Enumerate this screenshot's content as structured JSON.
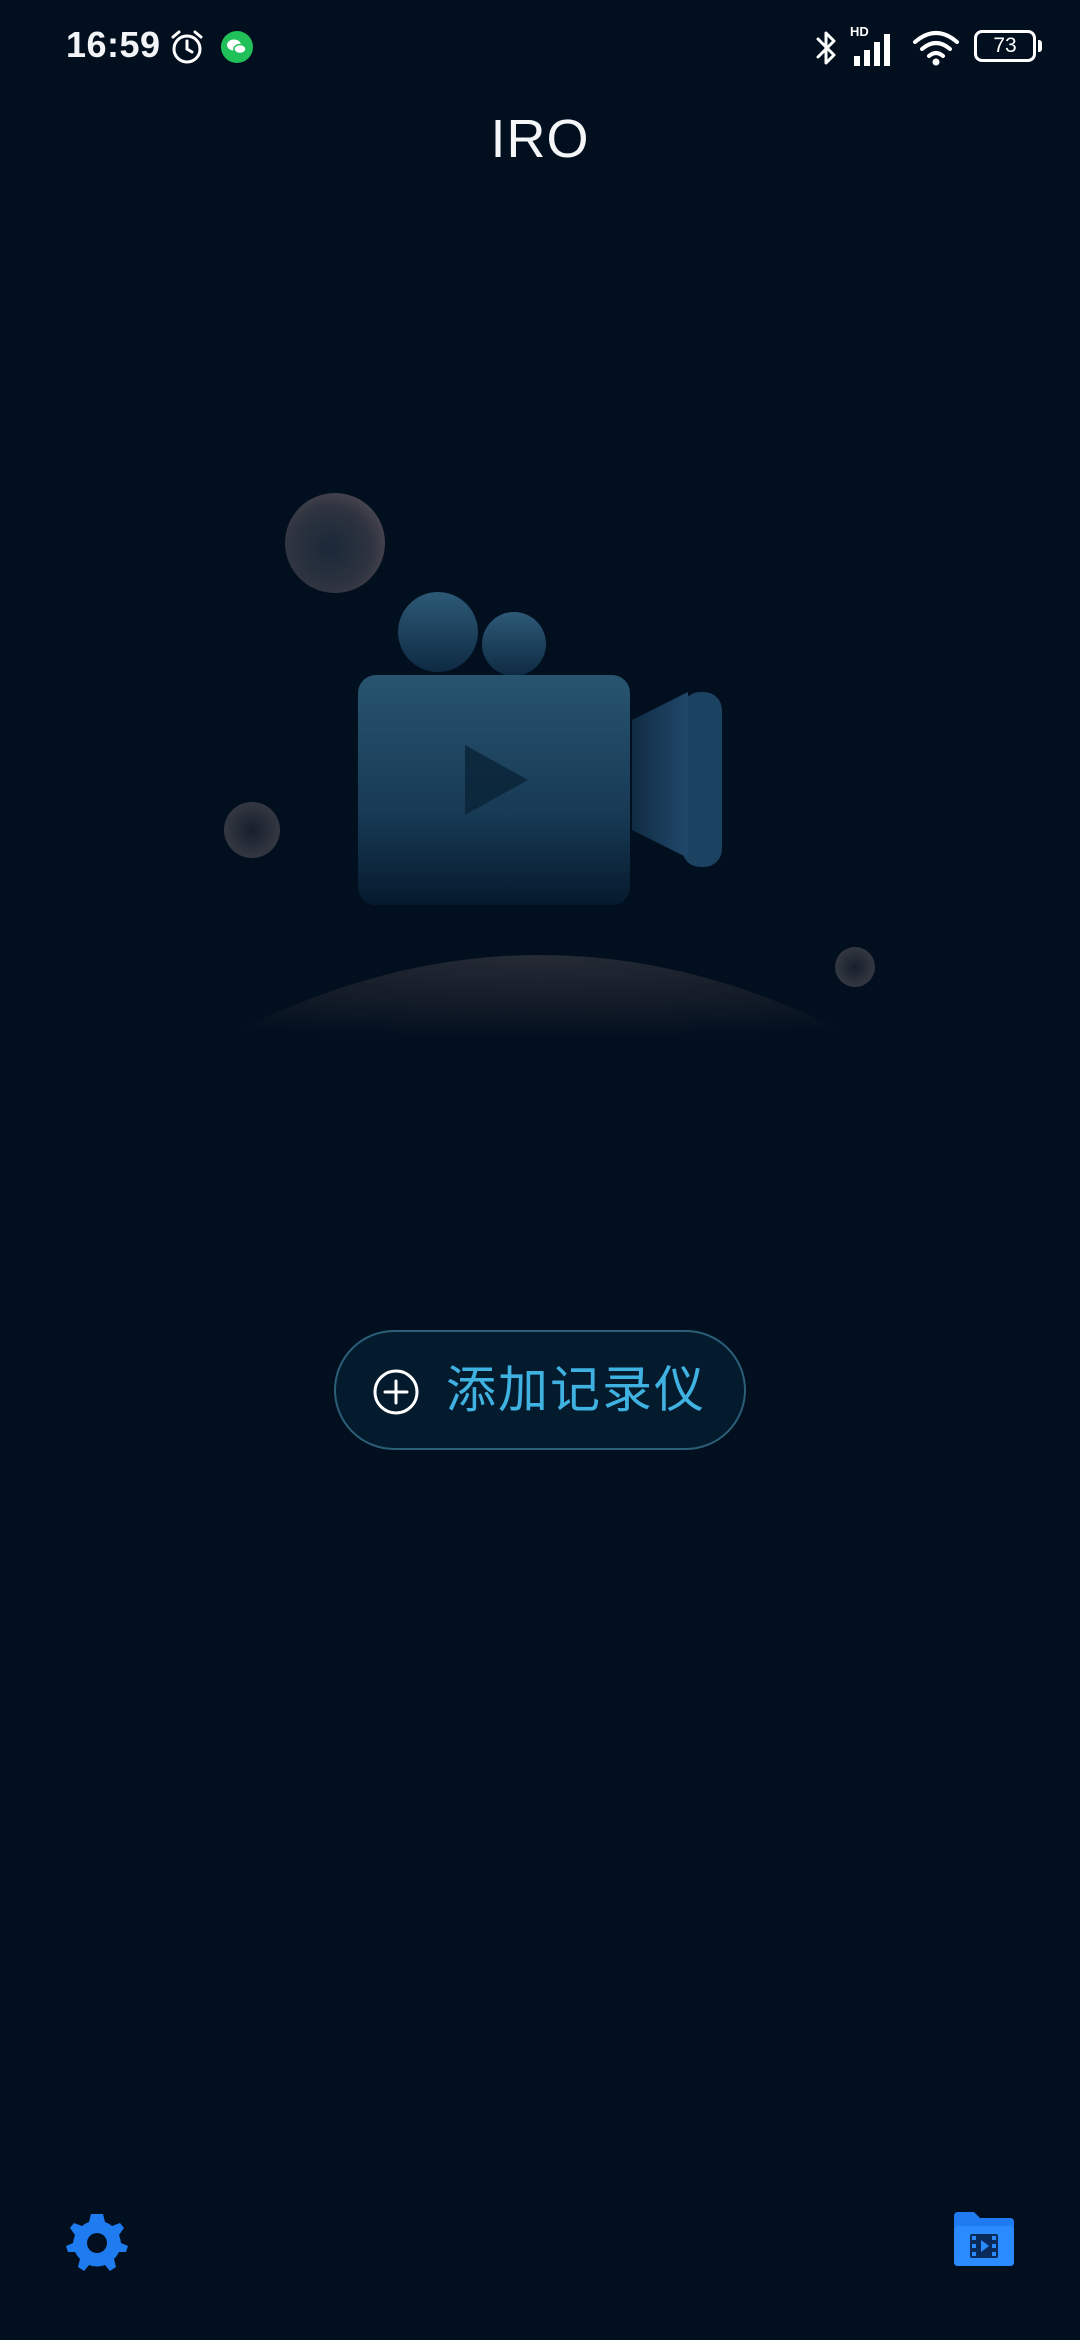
{
  "status_bar": {
    "time": "16:59",
    "alarm_icon": "alarm-clock-icon",
    "wechat_icon": "wechat-notification-icon",
    "bluetooth_icon": "bluetooth-icon",
    "signal_label": "HD",
    "signal_icon": "cell-signal-icon",
    "wifi_icon": "wifi-icon",
    "battery_level": "73"
  },
  "header": {
    "title": "IRO"
  },
  "illustration": {
    "icon": "video-camera-icon"
  },
  "main": {
    "add_button_label": "添加记录仪",
    "add_button_icon": "plus-circle-icon"
  },
  "bottom_bar": {
    "settings_icon": "gear-icon",
    "files_icon": "video-folder-icon"
  },
  "colors": {
    "background": "#020f1f",
    "accent": "#3fb2e1",
    "bottom_icon_blue": "#1e7cf0"
  }
}
